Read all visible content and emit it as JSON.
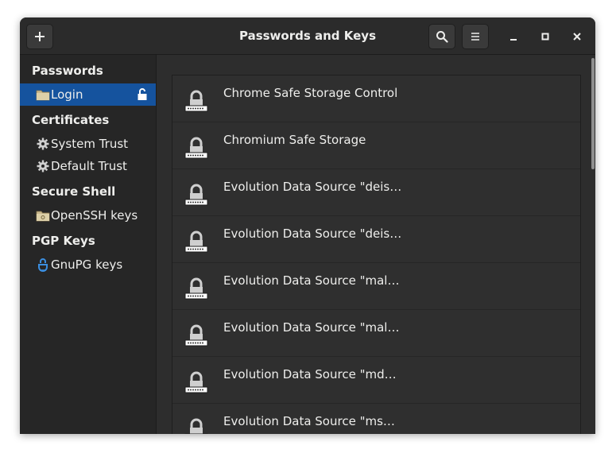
{
  "window": {
    "title": "Passwords and Keys",
    "add_button_icon": "plus-icon",
    "search_button_icon": "search-icon",
    "menu_button_icon": "hamburger-menu-icon",
    "minimize_icon": "minimize-icon",
    "maximize_icon": "maximize-icon",
    "close_icon": "close-icon"
  },
  "sidebar": {
    "sections": [
      {
        "title": "Passwords",
        "items": [
          {
            "label": "Login",
            "icon": "folder-icon",
            "selected": true,
            "trailing_icon": "unlocked-padlock-icon"
          }
        ]
      },
      {
        "title": "Certificates",
        "items": [
          {
            "label": "System Trust",
            "icon": "gear-icon"
          },
          {
            "label": "Default Trust",
            "icon": "gear-icon"
          }
        ]
      },
      {
        "title": "Secure Shell",
        "items": [
          {
            "label": "OpenSSH keys",
            "icon": "ssh-folder-icon"
          }
        ]
      },
      {
        "title": "PGP Keys",
        "items": [
          {
            "label": "GnuPG keys",
            "icon": "gnupg-icon"
          }
        ]
      }
    ]
  },
  "list": {
    "item_icon": "password-lock-icon",
    "items": [
      {
        "label": "Chrome Safe Storage Control"
      },
      {
        "label": "Chromium Safe Storage"
      },
      {
        "label": "Evolution Data Source \"deis…"
      },
      {
        "label": "Evolution Data Source \"deis…"
      },
      {
        "label": "Evolution Data Source \"mal…"
      },
      {
        "label": "Evolution Data Source \"mal…"
      },
      {
        "label": "Evolution Data Source \"md…"
      },
      {
        "label": "Evolution Data Source \"ms…"
      }
    ]
  },
  "colors": {
    "selection": "#15539e",
    "background": "#2d2d2d",
    "sidebar": "#262626",
    "text": "#eeeeec"
  }
}
